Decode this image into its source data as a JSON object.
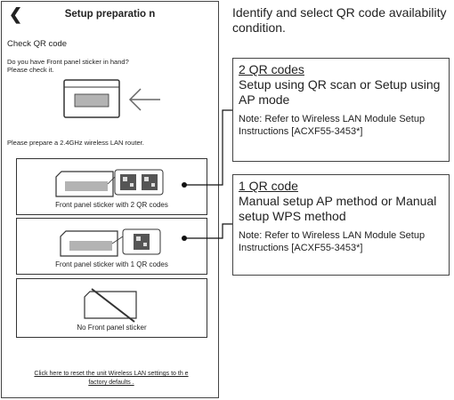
{
  "app": {
    "title": "Setup preparatio n",
    "back_icon": "chevron-left-icon"
  },
  "screen": {
    "section_title": "Check QR code",
    "question_line1": "Do you have Front panel sticker in hand?",
    "question_line2": "Please check it.",
    "router_note": "Please prepare a 2.4GHz wireless LAN router.",
    "options": [
      {
        "label": "Front panel sticker with 2 QR codes"
      },
      {
        "label": "Front panel sticker with 1 QR codes"
      },
      {
        "label": "No Front panel sticker"
      }
    ],
    "reset_line1": "Click here to reset the unit Wireless LAN settings to th      e",
    "reset_line2": "factory defaults  ."
  },
  "instructions": {
    "intro": "Identify and select QR code availability condition.",
    "boxes": [
      {
        "heading": "2 QR codes",
        "body": "Setup using QR scan or Setup using AP mode",
        "note": "Note: Refer to Wireless LAN Module Setup Instructions [ACXF55-3453*]"
      },
      {
        "heading": "1 QR code",
        "body": "Manual setup AP method or Manual setup WPS method",
        "note": "Note: Refer to Wireless LAN Module Setup Instructions [ACXF55-3453*]"
      }
    ]
  },
  "colors": {
    "border": "#444444",
    "sticker_gray": "#b3b3b3"
  }
}
